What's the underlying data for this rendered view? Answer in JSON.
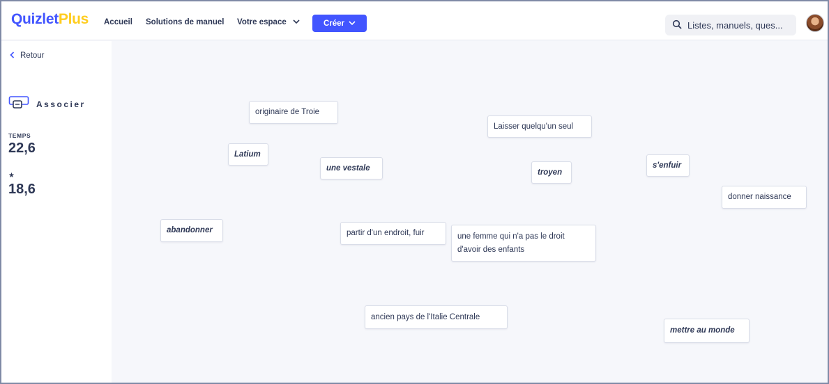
{
  "header": {
    "logo_main": "Quizlet",
    "logo_plus": "Plus",
    "nav": {
      "home": "Accueil",
      "solutions": "Solutions de manuel",
      "space": "Votre espace",
      "create": "Créer"
    },
    "search_placeholder": "Listes, manuels, ques..."
  },
  "sidebar": {
    "back_label": "Retour",
    "mode_label": "Associer",
    "time_label": "TEMPS",
    "time_value": "22,6",
    "best_icon": "★",
    "best_value": "18,6"
  },
  "cards": {
    "c1": "originaire de Troie",
    "c2": "Laisser quelqu'un seul",
    "c3": "Latium",
    "c4": "une vestale",
    "c5": "troyen",
    "c6": "s'enfuir",
    "c7": "donner naissance",
    "c8": "abandonner",
    "c9": "partir d'un endroit, fuir",
    "c10": "une femme qui n'a pas le droit d'avoir des enfants",
    "c11": "ancien pays de l'Italie Centrale",
    "c12": "mettre au monde"
  },
  "colors": {
    "brand_blue": "#4255ff",
    "brand_yellow": "#ffcd1f",
    "text": "#2e3856",
    "canvas": "#f6f7fb"
  }
}
